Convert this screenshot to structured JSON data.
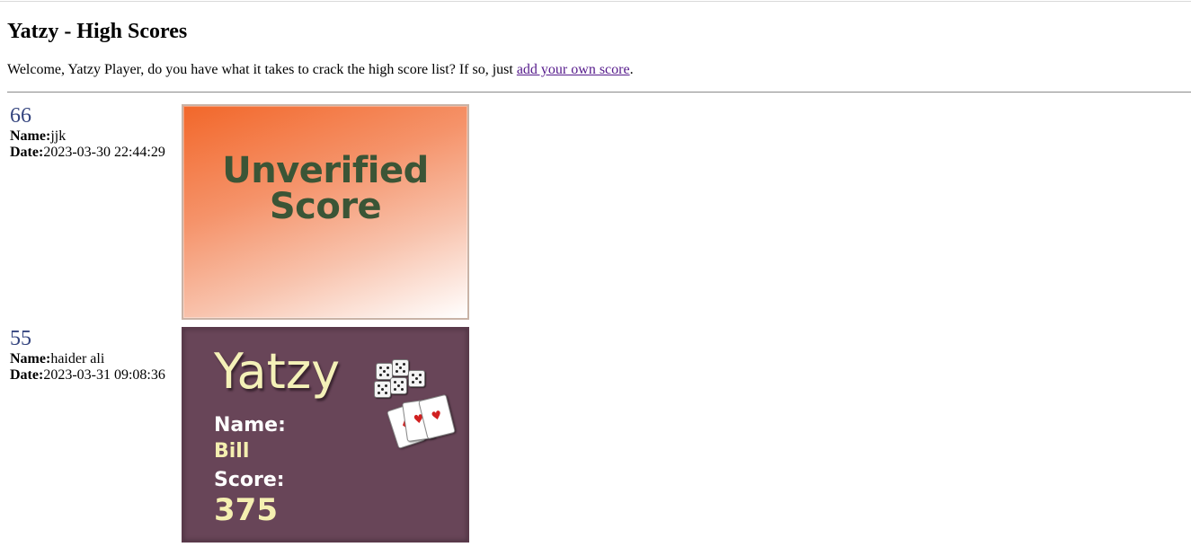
{
  "page": {
    "title": "Yatzy - High Scores",
    "intro_text": "Welcome, Yatzy Player, do you have what it takes to crack the high score list? If so, just ",
    "intro_link": "add your own score",
    "intro_end": "."
  },
  "labels": {
    "name": "Name:",
    "date": "Date:"
  },
  "scores": [
    {
      "score": "66",
      "name": "jjk",
      "date": "2023-03-30 22:44:29",
      "card": {
        "line1": "Unverified",
        "line2": "Score",
        "text_color": "#3b5536",
        "bg_color": "#f2672a"
      }
    },
    {
      "score": "55",
      "name": "haider ali",
      "date": "2023-03-31 09:08:36",
      "card": {
        "title": "Yatzy",
        "name_label": "Name:",
        "name_value": "Bill",
        "score_label": "Score:",
        "score_value": "375",
        "bg_color": "#684558",
        "icons": [
          "dice-icon",
          "playing-cards-icon"
        ]
      }
    }
  ],
  "colors": {
    "score_number": "#35457f",
    "link": "#551a8b"
  }
}
